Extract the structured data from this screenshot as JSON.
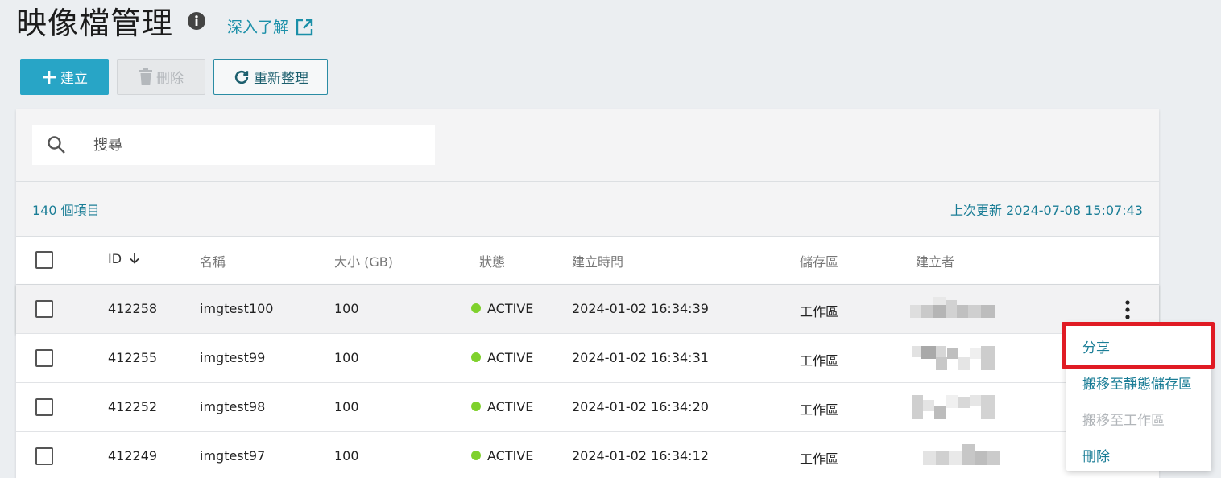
{
  "header": {
    "title": "映像檔管理",
    "learn_more": "深入了解"
  },
  "toolbar": {
    "create_label": "建立",
    "delete_label": "刪除",
    "refresh_label": "重新整理"
  },
  "search": {
    "placeholder": "搜尋"
  },
  "summary": {
    "item_count": "140 個項目",
    "last_update": "上次更新 2024-07-08 15:07:43"
  },
  "table": {
    "columns": {
      "id": "ID",
      "name": "名稱",
      "size": "大小 (GB)",
      "status": "狀態",
      "created_at": "建立時間",
      "storage": "儲存區",
      "creator": "建立者"
    },
    "sort_column": "ID",
    "sort_direction": "descending",
    "rows": [
      {
        "id": "412258",
        "name": "imgtest100",
        "size": "100",
        "status": "ACTIVE",
        "created_at": "2024-01-02 16:34:39",
        "storage": "工作區"
      },
      {
        "id": "412255",
        "name": "imgtest99",
        "size": "100",
        "status": "ACTIVE",
        "created_at": "2024-01-02 16:34:31",
        "storage": "工作區"
      },
      {
        "id": "412252",
        "name": "imgtest98",
        "size": "100",
        "status": "ACTIVE",
        "created_at": "2024-01-02 16:34:20",
        "storage": "工作區"
      },
      {
        "id": "412249",
        "name": "imgtest97",
        "size": "100",
        "status": "ACTIVE",
        "created_at": "2024-01-02 16:34:12",
        "storage": "工作區"
      }
    ]
  },
  "context_menu": {
    "items": [
      {
        "label": "分享",
        "enabled": true
      },
      {
        "label": "搬移至靜態儲存區",
        "enabled": true
      },
      {
        "label": "搬移至工作區",
        "enabled": false
      },
      {
        "label": "刪除",
        "enabled": true
      }
    ]
  },
  "colors": {
    "primary": "#28a5c6",
    "link": "#1a7d96",
    "status_active": "#7fd12c",
    "highlight_border": "#e01b24",
    "background": "#ebeef1"
  }
}
